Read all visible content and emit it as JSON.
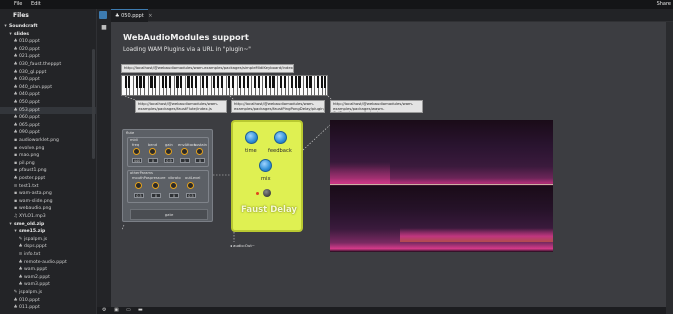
{
  "menu": {
    "file": "File",
    "edit": "Edit",
    "share": "Share"
  },
  "sidebar": {
    "title": "Files",
    "items": [
      {
        "label": "Soundcraft",
        "type": "root",
        "depth": 0,
        "glyph": "▾"
      },
      {
        "label": "slides",
        "type": "folder",
        "depth": 1,
        "glyph": "▾"
      },
      {
        "label": "010.pppt",
        "type": "file",
        "depth": 2,
        "glyph": "♣"
      },
      {
        "label": "020.pppt",
        "type": "file",
        "depth": 2,
        "glyph": "♣"
      },
      {
        "label": "021.pppt",
        "type": "file",
        "depth": 2,
        "glyph": "♣"
      },
      {
        "label": "030_faust.thepppt",
        "type": "file",
        "depth": 2,
        "glyph": "♣"
      },
      {
        "label": "030_gl.pppt",
        "type": "file",
        "depth": 2,
        "glyph": "♣"
      },
      {
        "label": "030.pppt",
        "type": "file",
        "depth": 2,
        "glyph": "♣"
      },
      {
        "label": "040_plan.pppt",
        "type": "file",
        "depth": 2,
        "glyph": "♣"
      },
      {
        "label": "040.pppt",
        "type": "file",
        "depth": 2,
        "glyph": "♣"
      },
      {
        "label": "050.pppt",
        "type": "file",
        "depth": 2,
        "glyph": "♣"
      },
      {
        "label": "053.pppt",
        "type": "file",
        "depth": 2,
        "glyph": "♣",
        "selected": true
      },
      {
        "label": "060.pppt",
        "type": "file",
        "depth": 2,
        "glyph": "♣"
      },
      {
        "label": "065.pppt",
        "type": "file",
        "depth": 2,
        "glyph": "♣"
      },
      {
        "label": "090.pppt",
        "type": "file",
        "depth": 2,
        "glyph": "♣"
      },
      {
        "label": "audioworklet.png",
        "type": "image",
        "depth": 2,
        "glyph": "▪"
      },
      {
        "label": "evolve.png",
        "type": "image",
        "depth": 2,
        "glyph": "▪"
      },
      {
        "label": "mao.png",
        "type": "image",
        "depth": 2,
        "glyph": "▪"
      },
      {
        "label": "pil.png",
        "type": "image",
        "depth": 2,
        "glyph": "▪"
      },
      {
        "label": "pfaust1.png",
        "type": "image",
        "depth": 2,
        "glyph": "▪"
      },
      {
        "label": "poster.pppt",
        "type": "file",
        "depth": 2,
        "glyph": "♣"
      },
      {
        "label": "test1.txt",
        "type": "text",
        "depth": 2,
        "glyph": "≡"
      },
      {
        "label": "wam-asta.png",
        "type": "image",
        "depth": 2,
        "glyph": "▪"
      },
      {
        "label": "wam-slide.png",
        "type": "image",
        "depth": 2,
        "glyph": "▪"
      },
      {
        "label": "webaudio.png",
        "type": "image",
        "depth": 2,
        "glyph": "▪"
      },
      {
        "label": "XYLO1.mp3",
        "type": "audio",
        "depth": 2,
        "glyph": "♫"
      },
      {
        "label": "sme_old.zip",
        "type": "folder",
        "depth": 1,
        "glyph": "▾"
      },
      {
        "label": "sme15.zip",
        "type": "folder",
        "depth": 2,
        "glyph": "▾"
      },
      {
        "label": "jspalpm.js",
        "type": "script",
        "depth": 3,
        "glyph": "✎"
      },
      {
        "label": "dsps.pppt",
        "type": "file",
        "depth": 3,
        "glyph": "♣"
      },
      {
        "label": "info.txt",
        "type": "text",
        "depth": 3,
        "glyph": "≡"
      },
      {
        "label": "remote-audio.pppt",
        "type": "file",
        "depth": 3,
        "glyph": "♣"
      },
      {
        "label": "wam.pppt",
        "type": "file",
        "depth": 3,
        "glyph": "♣"
      },
      {
        "label": "wam2.pppt",
        "type": "file",
        "depth": 3,
        "glyph": "♣"
      },
      {
        "label": "wam3.pppt",
        "type": "file",
        "depth": 3,
        "glyph": "♣"
      },
      {
        "label": "jspalpm.js",
        "type": "script",
        "depth": 2,
        "glyph": "✎"
      },
      {
        "label": "010.pppt",
        "type": "file",
        "depth": 2,
        "glyph": "♣"
      },
      {
        "label": "011.pppt",
        "type": "file",
        "depth": 2,
        "glyph": "♣"
      }
    ]
  },
  "tab": {
    "label": "050.pppt",
    "close": "×"
  },
  "slide": {
    "title": "WebAudioModules support",
    "subtitle": "Loading WAM Plugins via a URL in \"plugin~\"",
    "url_keyboard": "http://localhost/@webaudiomodules/wam-examples/packages/simpleMidiKeyboard/index.js",
    "url_synth": "http://localhost/@webaudiomodules/wam-examples/packages/faustFlute/index.js",
    "url_pingpong": "http://localhost/@webaudiomodules/wam-examples/packages/faustPingPongDelay/plugin/index.js",
    "url_spectro": "http://localhost/@webaudiomodules/wam-examples/packages/wasm-GuiSpectrogram/index.js",
    "out_node": "audio:Out~"
  },
  "synth": {
    "title": "flute",
    "group1": "midi",
    "knobs1": [
      "freq",
      "bend",
      "gain",
      "envAttack",
      "sustain"
    ],
    "values1": [
      "440",
      "0",
      "0.9",
      "1",
      "0"
    ],
    "group2": "otherParams",
    "knobs2": [
      "mouthPos",
      "pressure",
      "vibrato",
      "outLevel"
    ],
    "values2": [
      "0.5",
      "0",
      "0",
      "0.5"
    ],
    "gate": "gate"
  },
  "pedal": {
    "name": "Faust Delay",
    "knob1": "time",
    "knob2": "feedback",
    "knob3": "mix"
  },
  "colors": {
    "accent": "#3d7bb0",
    "pedal": "#dff052",
    "spectrogram_hot": "#e23d8f"
  }
}
